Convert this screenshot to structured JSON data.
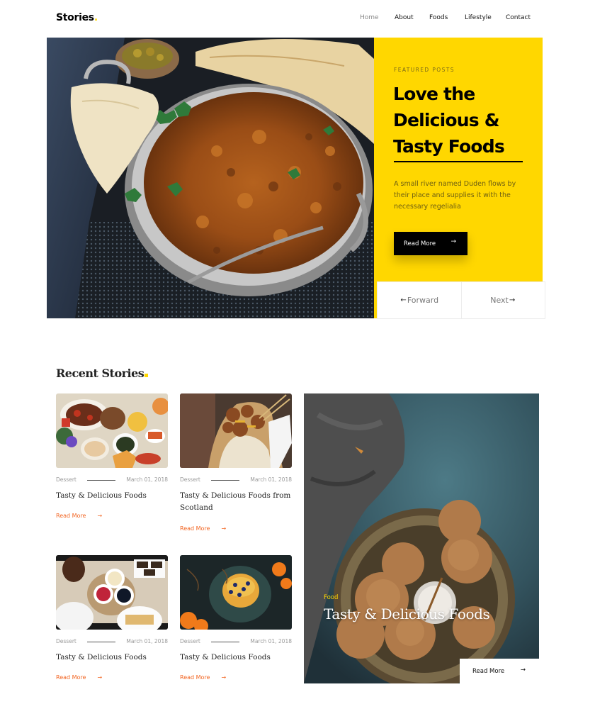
{
  "header": {
    "logo": "Stories",
    "logo_dot": ".",
    "nav": [
      {
        "label": "Home",
        "active": true
      },
      {
        "label": "About",
        "active": false
      },
      {
        "label": "Foods",
        "active": false
      },
      {
        "label": "Lifestyle",
        "active": false
      },
      {
        "label": "Contact",
        "active": false
      }
    ]
  },
  "hero": {
    "image_icon": "food-photo-curry-pan",
    "eyebrow": "FEATURED POSTS",
    "title": "Love the Delicious & Tasty Foods",
    "description": "A small river named Duden flows by their place and supplies it with the necessary regelialia",
    "button_label": "Read More",
    "button_arrow": "→",
    "prev_label": "Forward",
    "prev_arrow": "←",
    "next_label": "Next",
    "next_arrow": "→",
    "accent_color": "#ffd700"
  },
  "recent": {
    "title": "Recent Stories",
    "cards": [
      {
        "category": "Dessert",
        "date": "March 01, 2018",
        "title": "Tasty & Delicious Foods",
        "link": "Read More",
        "arrow": "→",
        "image": "feast-table-photo"
      },
      {
        "category": "Dessert",
        "date": "March 01, 2018",
        "title": "Tasty & Delicious Foods from Scotland",
        "link": "Read More",
        "arrow": "→",
        "image": "skewer-meat-photo"
      },
      {
        "category": "Dessert",
        "date": "March 01, 2018",
        "title": "Tasty & Delicious Foods",
        "link": "Read More",
        "arrow": "→",
        "image": "breakfast-waffles-photo"
      },
      {
        "category": "Dessert",
        "date": "March 01, 2018",
        "title": "Tasty & Delicious Foods",
        "link": "Read More",
        "arrow": "→",
        "image": "pancakes-oranges-photo"
      }
    ],
    "feature": {
      "category": "Food",
      "title": "Tasty & Delicious Foods",
      "button_label": "Read More",
      "button_arrow": "→",
      "image": "cookies-plate-photo"
    },
    "link_color": "#f26522"
  }
}
